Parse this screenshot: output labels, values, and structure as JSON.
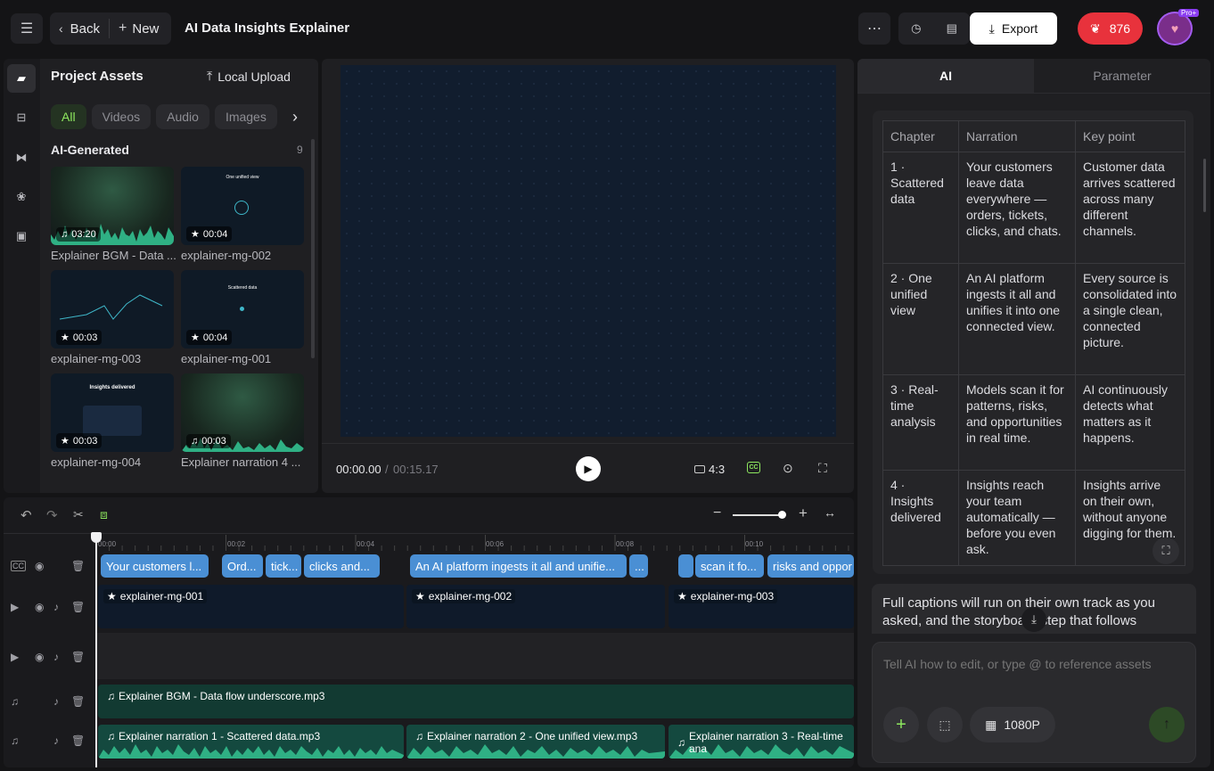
{
  "header": {
    "back_label": "Back",
    "new_label": "New",
    "title": "AI Data Insights Explainer",
    "export_label": "Export",
    "credits": "876",
    "pro_badge": "Pro+"
  },
  "assets": {
    "title": "Project Assets",
    "upload_label": "Local Upload",
    "filters": [
      "All",
      "Videos",
      "Audio",
      "Images"
    ],
    "section": "AI-Generated",
    "count": "9",
    "items": [
      {
        "label": "Explainer BGM - Data ...",
        "duration": "03:20",
        "kind": "audio"
      },
      {
        "label": "explainer-mg-002",
        "duration": "00:04",
        "kind": "mg",
        "caption": "One unified view"
      },
      {
        "label": "explainer-mg-003",
        "duration": "00:03",
        "kind": "mg"
      },
      {
        "label": "explainer-mg-001",
        "duration": "00:04",
        "kind": "mg",
        "caption": "Scattered data"
      },
      {
        "label": "explainer-mg-004",
        "duration": "00:03",
        "kind": "mg",
        "caption": "Insights delivered"
      },
      {
        "label": "Explainer narration 4 ...",
        "duration": "00:03",
        "kind": "audio"
      }
    ]
  },
  "preview": {
    "current": "00:00.00",
    "separator": "/",
    "total": "00:15.17",
    "aspect": "4:3"
  },
  "right": {
    "tabs": [
      "AI",
      "Parameter"
    ],
    "table": {
      "headers": [
        "Chapter",
        "Narration",
        "Key point"
      ],
      "rows": [
        [
          "1 · Scattered data",
          "Your customers leave data everywhere — orders, tickets, clicks, and chats.",
          "Customer data arrives scattered across many different channels."
        ],
        [
          "2 · One unified view",
          "An AI platform ingests it all and unifies it into one connected view.",
          "Every source is consolidated into a single clean, connected picture."
        ],
        [
          "3 · Real-time analysis",
          "Models scan it for patterns, risks, and opportunities in real time.",
          "AI continuously detects what matters as it happens."
        ],
        [
          "4 · Insights delivered",
          "Insights reach your team automatically — before you even ask.",
          "Insights arrive on their own, without anyone digging for them."
        ]
      ]
    },
    "message": "Full captions will run on their own track as you asked, and the storyboard step that follows",
    "input_placeholder": "Tell AI how to edit, or type @ to reference assets",
    "resolution": "1080P"
  },
  "timeline": {
    "ruler": [
      "00:00",
      "00:02",
      "00:04",
      "00:06",
      "00:08",
      "00:10"
    ],
    "captions": [
      "Your customers l...",
      "Ord...",
      "tick...",
      "clicks and...",
      "An AI platform ingests it all and unifie...",
      "...",
      "",
      "scan it fo...",
      "risks and oppor"
    ],
    "video_clips": [
      "explainer-mg-001",
      "explainer-mg-002",
      "explainer-mg-003"
    ],
    "bgm": "Explainer BGM - Data flow underscore.mp3",
    "narrations": [
      "Explainer narration 1 - Scattered data.mp3",
      "Explainer narration 2 - One unified view.mp3",
      "Explainer narration 3 - Real-time ana"
    ]
  },
  "colors": {
    "accent_green": "#8ee85f",
    "credits_red": "#e8323c",
    "caption_blue": "#4a8fd4",
    "audio_teal": "#14493f"
  }
}
